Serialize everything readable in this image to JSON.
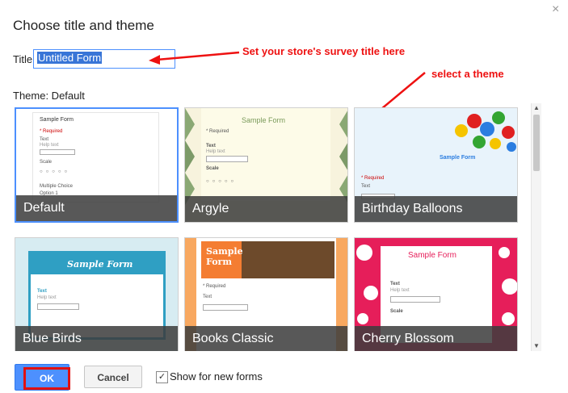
{
  "dialog": {
    "title": "Choose title and theme",
    "close_glyph": "×",
    "title_label": "Title",
    "title_value": "Untitled Form",
    "theme_label": "Theme: Default"
  },
  "annotations": {
    "title_note": "Set your store's survey title here",
    "theme_note": "select a theme",
    "color": "#ee1111"
  },
  "themes": [
    {
      "label": "Default",
      "selected": true
    },
    {
      "label": "Argyle",
      "selected": false
    },
    {
      "label": "Birthday Balloons",
      "selected": false
    },
    {
      "label": "Blue Birds",
      "selected": false
    },
    {
      "label": "Books Classic",
      "selected": false
    },
    {
      "label": "Cherry Blossom",
      "selected": false
    }
  ],
  "preview": {
    "sample_form": "Sample Form",
    "text": "Text",
    "help_text": "Help text",
    "scale": "Scale",
    "multiple_choice": "Multiple Choice",
    "option_1": "Option 1",
    "required": "* Required"
  },
  "footer": {
    "ok_label": "OK",
    "cancel_label": "Cancel",
    "show_label": "Show for new forms",
    "show_checked": true,
    "check_glyph": "✓"
  },
  "colors": {
    "accent": "#4d90fe",
    "caption_bg": "#3c3c3c"
  }
}
